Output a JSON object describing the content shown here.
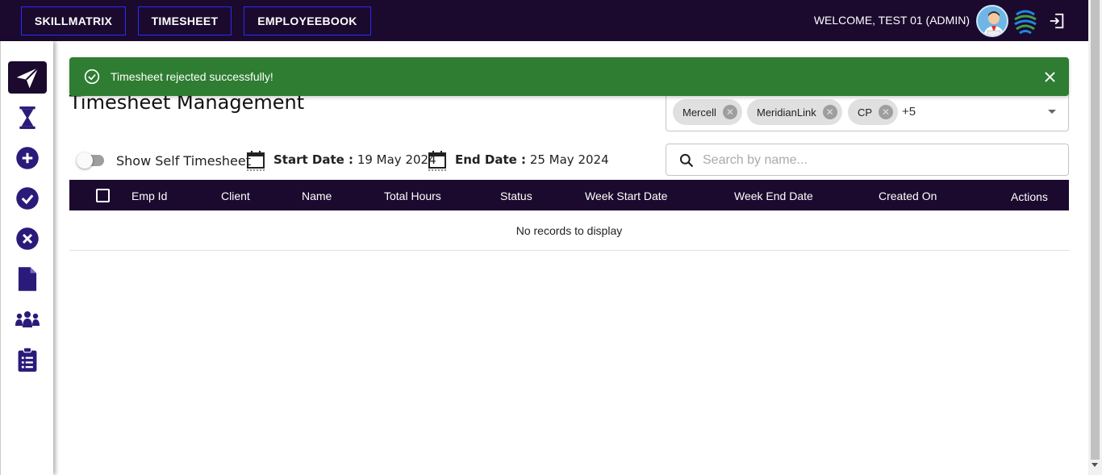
{
  "topnav": {
    "items": [
      "SKILLMATRIX",
      "TIMESHEET",
      "EMPLOYEEBOOK"
    ],
    "welcome": "WELCOME, TEST 01 (ADMIN)",
    "avatar_icon": "user-avatar",
    "logo_icon": "globe-logo",
    "logout_icon": "logout-icon"
  },
  "sidebar": {
    "items": [
      {
        "icon": "send-icon",
        "active": true
      },
      {
        "icon": "hourglass-icon"
      },
      {
        "icon": "add-circle-icon"
      },
      {
        "icon": "check-circle-icon"
      },
      {
        "icon": "cancel-circle-icon"
      },
      {
        "icon": "document-icon"
      },
      {
        "icon": "team-icon"
      },
      {
        "icon": "clipboard-list-icon"
      }
    ]
  },
  "toast": {
    "message": "Timesheet rejected successfully!",
    "icon": "check-circle-outline-icon",
    "close_icon": "close-icon",
    "color": "#2e7d32"
  },
  "page": {
    "title": "Timesheet Management"
  },
  "client_filter": {
    "chips": [
      "Mercell",
      "MeridianLink",
      "CP"
    ],
    "more": "+5"
  },
  "filters": {
    "toggle_label": "Show Self Timesheet",
    "start_label": "Start Date :",
    "start_value": "19 May 2024",
    "end_label": "End Date :",
    "end_value": "25 May 2024"
  },
  "search": {
    "placeholder": "Search by name...",
    "value": ""
  },
  "table": {
    "columns": [
      "Emp Id",
      "Client",
      "Name",
      "Total Hours",
      "Status",
      "Week Start Date",
      "Week End Date",
      "Created On",
      "Actions"
    ],
    "empty_message": "No records to display"
  },
  "colors": {
    "primary": "#1b0a2e",
    "accent": "#2a1b7a",
    "success": "#2e7d32"
  }
}
